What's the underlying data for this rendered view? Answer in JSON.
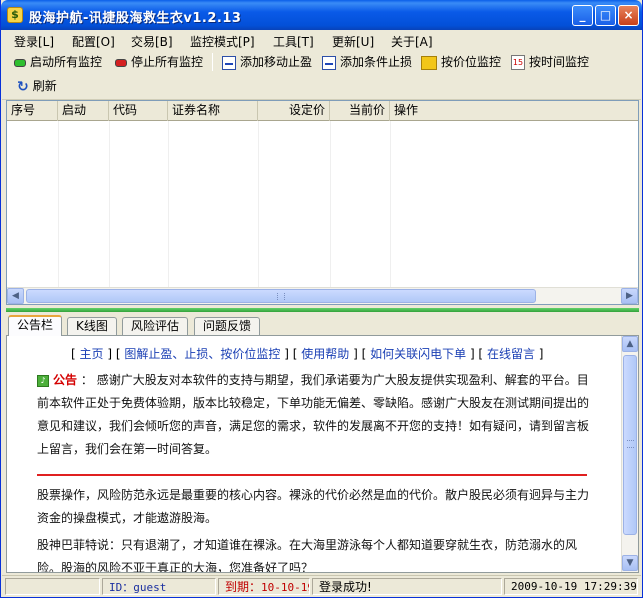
{
  "window": {
    "title": "股海护航-讯捷股海救生衣v1.2.13",
    "controls": {
      "minimize": "_",
      "maximize": "□",
      "close": "×"
    }
  },
  "menu": [
    {
      "label": "登录[L]"
    },
    {
      "label": "配置[O]"
    },
    {
      "label": "交易[B]"
    },
    {
      "label": "监控模式[P]"
    },
    {
      "label": "工具[T]"
    },
    {
      "label": "更新[U]"
    },
    {
      "label": "关于[A]"
    }
  ],
  "toolbar": {
    "start_all": "启动所有监控",
    "stop_all": "停止所有监控",
    "add_trailing_stop": "添加移动止盈",
    "add_conditional_stop": "添加条件止损",
    "price_monitor": "按价位监控",
    "time_monitor": "按时间监控",
    "refresh": "刷新",
    "calendar_icon_text": "15"
  },
  "table": {
    "columns": [
      "序号",
      "启动",
      "代码",
      "证券名称",
      "设定价",
      "当前价",
      "操作"
    ],
    "rows": []
  },
  "tabs": [
    "公告栏",
    "K线图",
    "风险评估",
    "问题反馈"
  ],
  "notice": {
    "links": {
      "open": "[",
      "home": "主页",
      "sep1": "] [",
      "howto": "图解止盈、止损、按价位监控",
      "sep2": "] [",
      "help": "使用帮助",
      "sep3": "] [",
      "flash": "如何关联闪电下单",
      "sep4": "] [",
      "guestbook": "在线留言",
      "close": "]"
    },
    "label": "公告",
    "colon": "：",
    "announcement": "感谢广大股友对本软件的支持与期望，我们承诺要为广大股友提供实现盈利、解套的平台。目前本软件正处于免费体验期，版本比较稳定，下单功能无偏差、零缺陷。感谢广大股友在测试期间提出的意见和建议，我们会倾听您的声音，满足您的需求，软件的发展离不开您的支持！如有疑问，请到留言板上留言，我们会在第一时间答复。",
    "para2": "股票操作，风险防范永远是最重要的核心内容。裸泳的代价必然是血的代价。散户股民必须有迥异与主力资金的操盘模式，才能遨游股海。",
    "para3": "股神巴菲特说：只有退潮了，才知道谁在裸泳。在大海里游泳每个人都知道要穿就生衣，防范溺水的风险。股海的风险不亚于真正的大海，您准备好了吗？"
  },
  "status": {
    "id_label": "ID：",
    "id_value": "guest",
    "expiry_label": "到期：",
    "expiry_value": "10-10-19",
    "login_msg": "登录成功!",
    "datetime": "2009-10-19 17:29:39"
  }
}
